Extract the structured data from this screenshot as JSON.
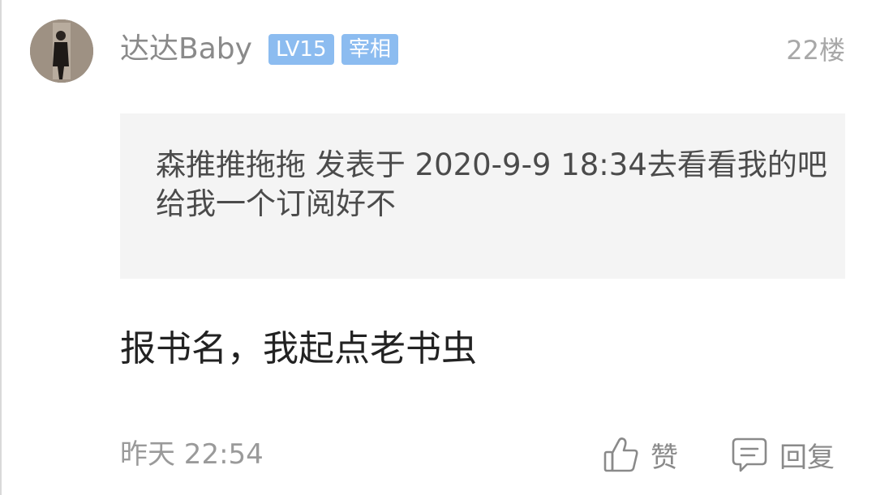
{
  "post": {
    "author": {
      "name": "达达Baby",
      "level_badge": "LV15",
      "title_badge": "宰相"
    },
    "floor": "22楼",
    "quote": "森推推拖拖 发表于 2020-9-9 18:34去看看我的吧给我一个订阅好不",
    "content": "报书名，我起点老书虫",
    "timestamp": "昨天 22:54"
  },
  "actions": {
    "like": {
      "label": "赞",
      "icon": "thumbs-up-icon"
    },
    "reply": {
      "label": "回复",
      "icon": "comment-icon"
    }
  },
  "colors": {
    "badge_bg": "#8cbcf0",
    "quote_bg": "#f4f4f4",
    "muted_text": "#8a8a8a",
    "body_text": "#222222"
  }
}
